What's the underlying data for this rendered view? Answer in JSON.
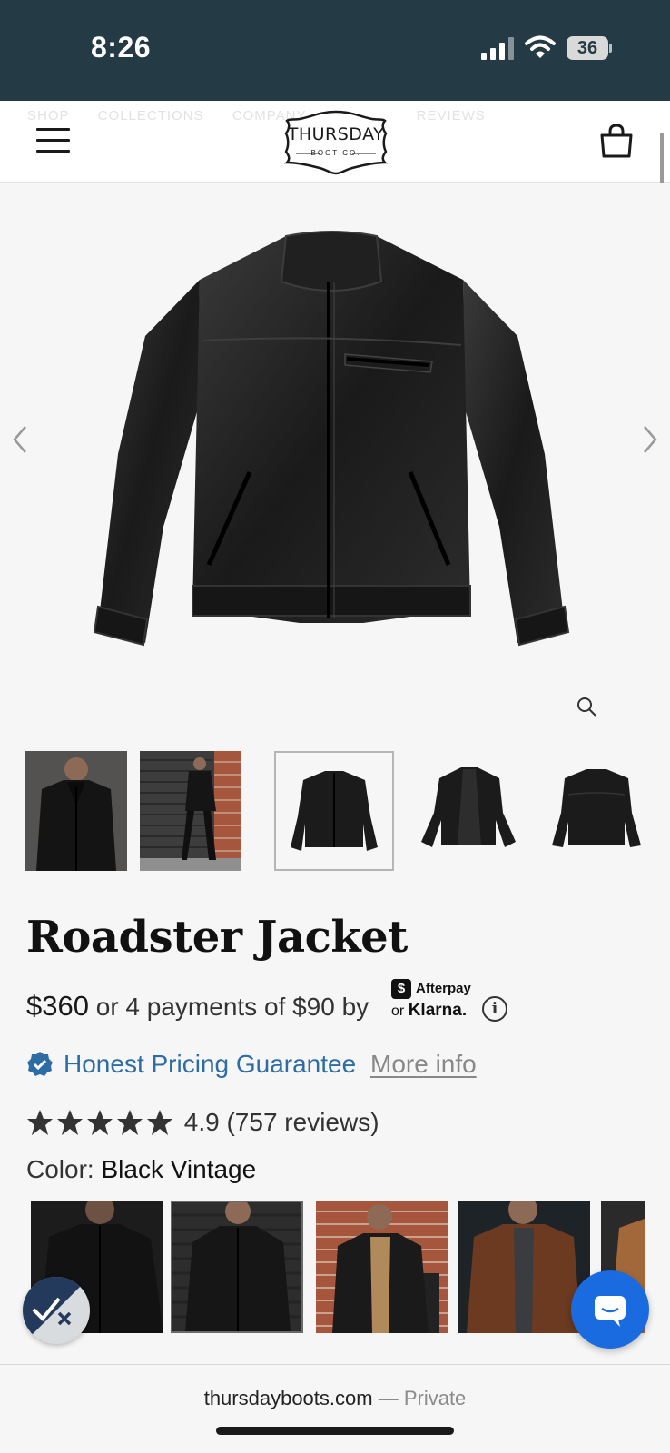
{
  "status_bar": {
    "time": "8:26",
    "battery": "36",
    "icons": [
      "signal-icon",
      "wifi-icon",
      "battery-icon"
    ]
  },
  "header": {
    "ghost_nav": [
      "SHOP",
      "COLLECTIONS",
      "COMPANY",
      "REVIEWS"
    ],
    "logo_text": "THURSDAY",
    "logo_sub": "BOOT CO.",
    "icons": [
      "menu-icon",
      "shopping-bag-icon"
    ]
  },
  "gallery": {
    "icons": [
      "chevron-left-icon",
      "chevron-right-icon",
      "zoom-icon"
    ],
    "thumbnails": [
      "model-front-photo",
      "model-street-photo",
      "jacket-front",
      "jacket-open",
      "jacket-back"
    ],
    "selected_thumbnail": 2
  },
  "product": {
    "title": "Roadster Jacket",
    "price": "$360",
    "installments": "or 4 payments of $90 by",
    "afterpay_label": "Afterpay",
    "afterpay_symbol": "$",
    "klarna_prefix": "or",
    "klarna_label": "Klarna.",
    "guarantee_label": "Honest Pricing Guarantee",
    "more_info_label": "More info",
    "rating": 4.9,
    "rating_text": "4.9 (757 reviews)",
    "stars": 5,
    "color_label": "Color:",
    "color_value": "Black Vintage"
  },
  "swatches": [
    "Black Vintage",
    "Black",
    "Black with Tan Shirt",
    "Brown",
    "Tan"
  ],
  "selected_swatch": 1,
  "browser": {
    "url": "thursdayboots.com",
    "mode": "— Private"
  },
  "colors": {
    "status_bar_bg": "#243a44",
    "link_blue": "#2e6da4",
    "chat_fab": "#1a6ae0"
  }
}
